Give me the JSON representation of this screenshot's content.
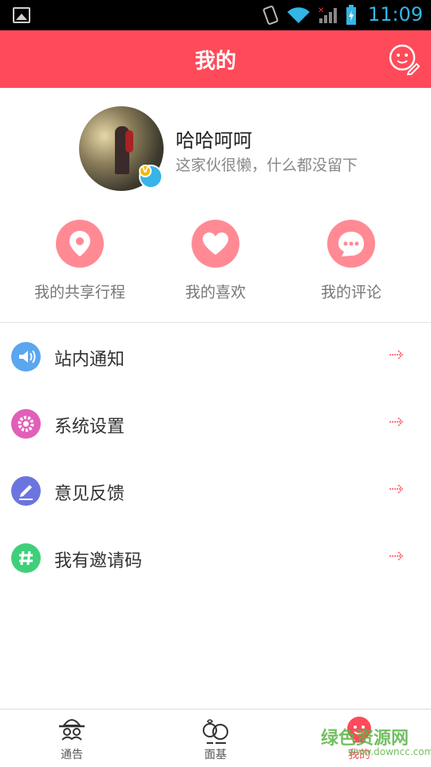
{
  "status_bar": {
    "time": "11:09"
  },
  "header": {
    "title": "我的",
    "edit_icon": "smiley-pencil-icon"
  },
  "profile": {
    "username": "哈哈呵呵",
    "signature": "这家伙很懒，什么都没留下",
    "badge": "V"
  },
  "quick_actions": [
    {
      "label": "我的共享行程",
      "icon": "location-pin-icon"
    },
    {
      "label": "我的喜欢",
      "icon": "heart-icon"
    },
    {
      "label": "我的评论",
      "icon": "chat-bubble-icon"
    }
  ],
  "menu": [
    {
      "label": "站内通知",
      "icon": "speaker-icon",
      "color": "#5aa6ef"
    },
    {
      "label": "系统设置",
      "icon": "gear-icon",
      "color": "#e15fb8"
    },
    {
      "label": "意见反馈",
      "icon": "pen-icon",
      "color": "#6b75de"
    },
    {
      "label": "我有邀请码",
      "icon": "hashtag-icon",
      "color": "#3fcf7a"
    }
  ],
  "bottom_nav": [
    {
      "label": "通告",
      "icon": "hat-mustache-icon"
    },
    {
      "label": "面基",
      "icon": "couple-icon"
    },
    {
      "label": "我的",
      "icon": "profile-face-icon",
      "active": true
    }
  ],
  "watermark": {
    "main": "绿色资源网",
    "sub": "www.downcc.com"
  },
  "colors": {
    "accent": "#ff4a5a",
    "quick_circle": "#ff8a94"
  }
}
